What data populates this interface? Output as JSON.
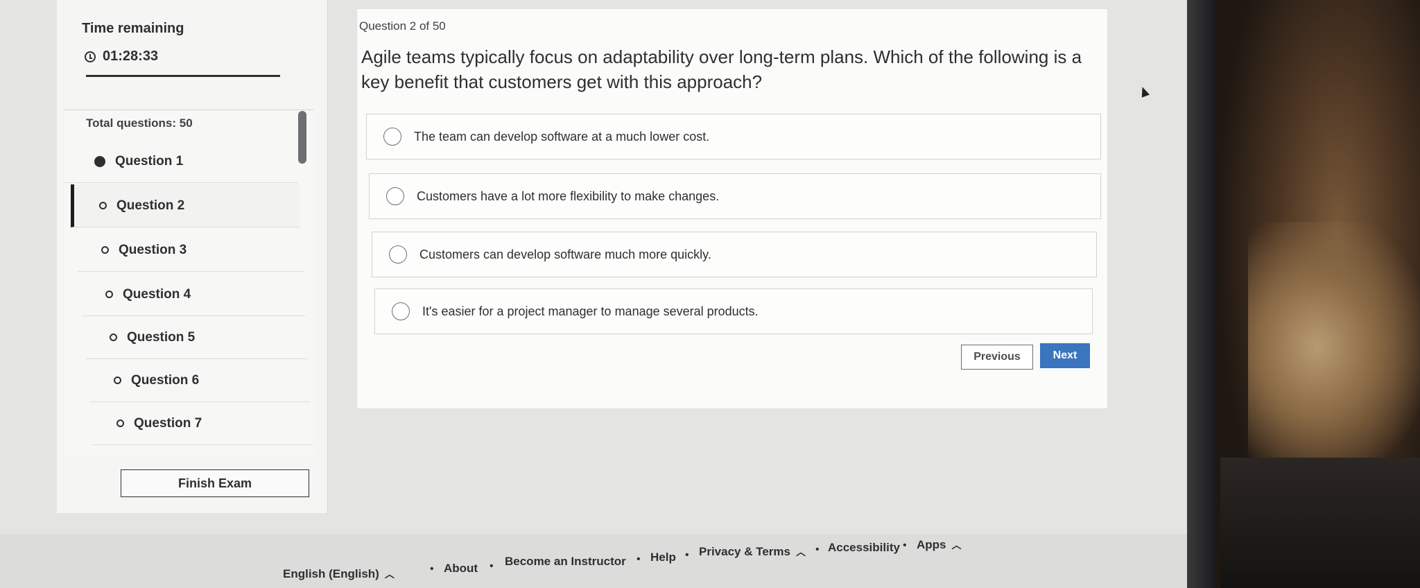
{
  "sidebar": {
    "timer_label": "Time remaining",
    "timer_value": "01:28:33",
    "total_questions": "Total questions: 50",
    "questions": [
      {
        "label": "Question 1",
        "answered": true
      },
      {
        "label": "Question 2",
        "answered": false,
        "current": true
      },
      {
        "label": "Question 3",
        "answered": false
      },
      {
        "label": "Question 4",
        "answered": false
      },
      {
        "label": "Question 5",
        "answered": false
      },
      {
        "label": "Question 6",
        "answered": false
      },
      {
        "label": "Question 7",
        "answered": false
      }
    ],
    "finish_label": "Finish Exam"
  },
  "main": {
    "question_number": "Question 2 of 50",
    "question_text": "Agile teams typically focus on adaptability over long-term plans. Which of the following is a key benefit that customers get with this approach?",
    "options": [
      "The team can develop software at a much lower cost.",
      "Customers have a lot more flexibility to make changes.",
      "Customers can develop software much more quickly.",
      "It's easier for a project manager to manage several products."
    ],
    "previous_label": "Previous",
    "next_label": "Next"
  },
  "footer": {
    "language": "English (English)",
    "links": [
      "About",
      "Become an Instructor",
      "Help",
      "Privacy & Terms",
      "Accessibility",
      "Apps"
    ],
    "separator": "•"
  },
  "colors": {
    "accent": "#3b74bf",
    "text": "#2d2f31"
  },
  "icons": [
    "clock-icon",
    "radio-icon",
    "chevron-up-icon"
  ]
}
